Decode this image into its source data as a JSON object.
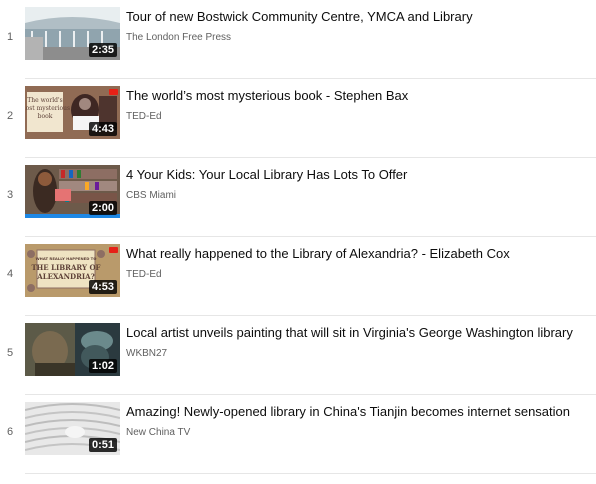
{
  "colors": {
    "title": "#0d0d0d",
    "channel": "#606060",
    "duration_bg": "#000000",
    "duration_fg": "#ffffff",
    "divider": "#e6e6e6"
  },
  "videos": [
    {
      "index": "1",
      "title": "Tour of new Bostwick Community Centre, YMCA and Library",
      "channel": "The London Free Press",
      "duration": "2:35"
    },
    {
      "index": "2",
      "title": "The world’s most mysterious book - Stephen Bax",
      "channel": "TED-Ed",
      "duration": "4:43",
      "thumb_text": "The world's most mysterious book"
    },
    {
      "index": "3",
      "title": "4 Your Kids: Your Local Library Has Lots To Offer",
      "channel": "CBS Miami",
      "duration": "2:00"
    },
    {
      "index": "4",
      "title": "What really happened to the Library of Alexandria? - Elizabeth Cox",
      "channel": "TED-Ed",
      "duration": "4:53",
      "thumb_text": "WHAT REALLY HAPPENED TO THE LIBRARY OF ALEXANDRIA?"
    },
    {
      "index": "5",
      "title": "Local artist unveils painting that will sit in Virginia's George Washington library",
      "channel": "WKBN27",
      "duration": "1:02"
    },
    {
      "index": "6",
      "title": "Amazing! Newly-opened library in China's Tianjin becomes internet sensation",
      "channel": "New China TV",
      "duration": "0:51"
    }
  ]
}
